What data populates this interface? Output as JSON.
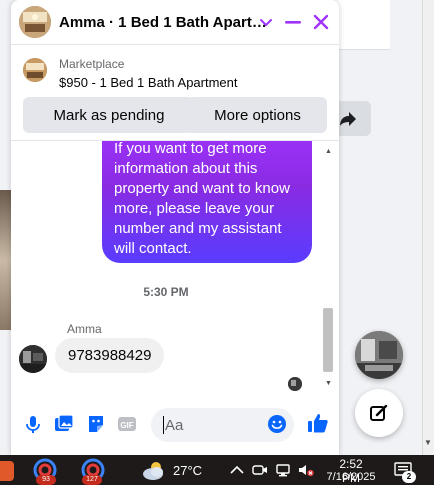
{
  "chat": {
    "title": "Amma · 1 Bed 1 Bath Apart…",
    "listing": {
      "category": "Marketplace",
      "title": "$950 - 1 Bed 1 Bath Apartment"
    },
    "actions": {
      "mark_pending": "Mark as pending",
      "more_options": "More options"
    },
    "messages": {
      "sent_text": "If you want to get more information about this property and want to know more, please leave your number and my assistant will contact.",
      "timestamp": "5:30 PM",
      "sender_name": "Amma",
      "received_text": "9783988429"
    },
    "composer": {
      "placeholder": "Aa"
    },
    "colors": {
      "accent": "#a033ff",
      "accent_end": "#5a3cff",
      "icon_blue": "#0866ff",
      "header_icon": "#a033ff"
    }
  },
  "taskbar": {
    "badges": [
      "93",
      "127"
    ],
    "temperature": "27°C",
    "time": "2:52 PM",
    "date": "7/16/2025",
    "notification_count": "2"
  }
}
